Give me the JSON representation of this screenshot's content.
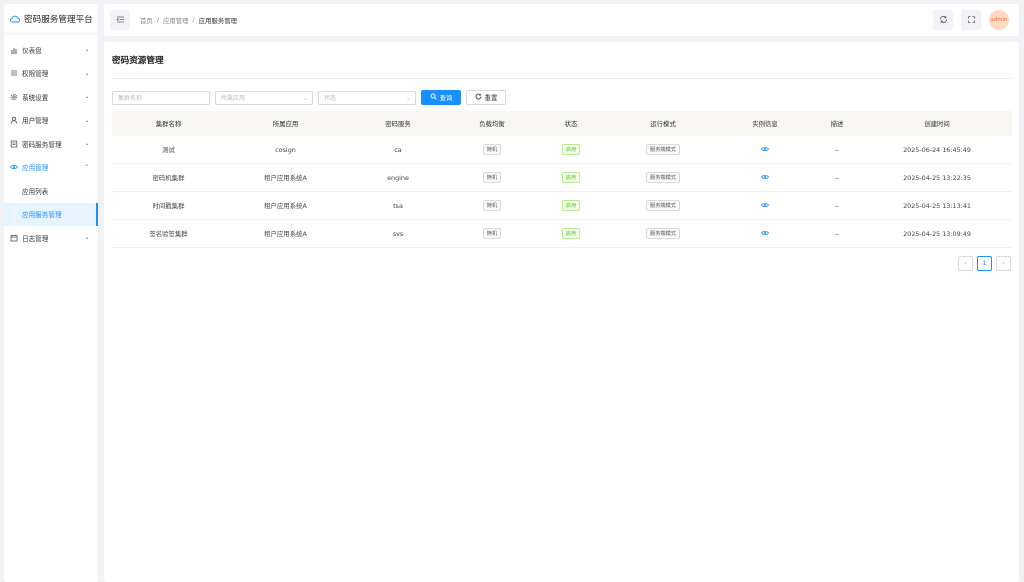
{
  "app": {
    "title": "密码服务管理平台"
  },
  "sidebar": {
    "items": [
      {
        "label": "仪表盘",
        "icon": "chart-icon"
      },
      {
        "label": "权限管理",
        "icon": "list-icon"
      },
      {
        "label": "系统设置",
        "icon": "gear-icon"
      },
      {
        "label": "用户管理",
        "icon": "user-icon"
      },
      {
        "label": "密码服务管理",
        "icon": "doc-icon"
      },
      {
        "label": "应用管理",
        "icon": "eye-icon"
      },
      {
        "label": "日志管理",
        "icon": "calendar-icon"
      }
    ],
    "sub_items": [
      "应用列表",
      "应用服务管理"
    ]
  },
  "header": {
    "breadcrumb": [
      "首页",
      "/",
      "应用管理",
      "/",
      "应用服务管理"
    ],
    "avatar": "admin"
  },
  "main": {
    "title": "密码资源管理",
    "filters": {
      "cluster_placeholder": "集群名称",
      "app_placeholder": "所属应用",
      "status_placeholder": "状态",
      "search_label": "查询",
      "reset_label": "重置"
    },
    "table": {
      "columns": [
        "集群名称",
        "所属应用",
        "密码服务",
        "负载均衡",
        "状态",
        "运行模式",
        "实例信息",
        "描述",
        "创建时间"
      ],
      "rows": [
        {
          "name": "测试",
          "app": "cosign",
          "service": "ca",
          "lb": "随机",
          "status": "启用",
          "mode": "服务端模式",
          "desc": "--",
          "created": "2025-06-24 16:45:49"
        },
        {
          "name": "密码机集群",
          "app": "租户应用系统A",
          "service": "engine",
          "lb": "随机",
          "status": "启用",
          "mode": "服务端模式",
          "desc": "--",
          "created": "2025-04-25 13:22:35"
        },
        {
          "name": "时间戳集群",
          "app": "租户应用系统A",
          "service": "tsa",
          "lb": "随机",
          "status": "启用",
          "mode": "服务端模式",
          "desc": "--",
          "created": "2025-04-25 13:13:41"
        },
        {
          "name": "签名验签集群",
          "app": "租户应用系统A",
          "service": "svs",
          "lb": "随机",
          "status": "启用",
          "mode": "服务端模式",
          "desc": "--",
          "created": "2025-04-25 13:09:49"
        }
      ]
    },
    "pagination": {
      "prev": "‹",
      "page": "1",
      "next": "›"
    }
  },
  "colors": {
    "accent": "#1890ff",
    "success": "#52c41a",
    "active_bg": "#e6f4ff"
  }
}
